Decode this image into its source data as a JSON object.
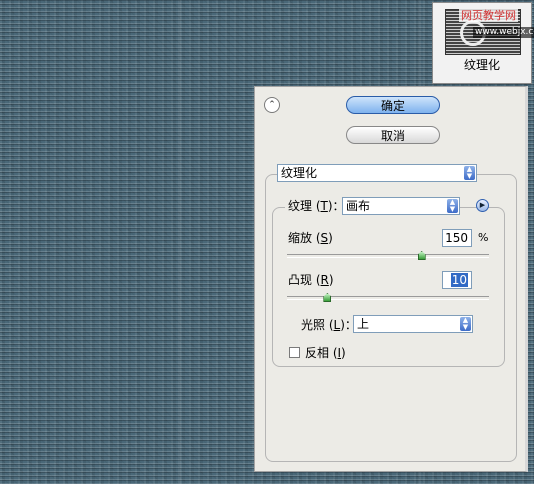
{
  "thumbnail": {
    "watermark_top": "网页教学网",
    "watermark_url": "www.webjx.com",
    "caption": "纹理化"
  },
  "panel": {
    "ok_label": "确定",
    "cancel_label": "取消",
    "filter_select": "纹理化",
    "texture_label_main": "纹理 (",
    "texture_label_key": "T",
    "texture_label_end": ")：",
    "texture_value": "画布",
    "scaling_label_main": "缩放 (",
    "scaling_label_key": "S",
    "scaling_label_end": ")",
    "scaling_value": "150",
    "scaling_unit": "%",
    "scaling_percent": 150,
    "relief_label_main": "凸现 (",
    "relief_label_key": "R",
    "relief_label_end": ")",
    "relief_value": "10",
    "relief_level": 10,
    "light_label_main": "光照 (",
    "light_label_key": "L",
    "light_label_end": ")：",
    "light_value": "上",
    "invert_label_main": "反相 (",
    "invert_label_key": "I",
    "invert_label_end": ")",
    "invert_checked": false
  }
}
